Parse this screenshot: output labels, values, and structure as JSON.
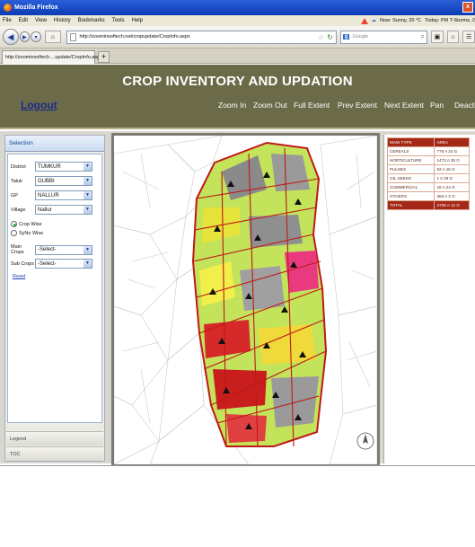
{
  "window": {
    "title": "Mozilla Firefox",
    "close_glyph": "x"
  },
  "menu": [
    "File",
    "Edit",
    "View",
    "History",
    "Bookmarks",
    "Tools",
    "Help"
  ],
  "status": {
    "weather": "Now: Sunny, 20 °C",
    "today": "Today: PM T-Storms, 2"
  },
  "browser": {
    "url": "http://zoominsoftech.net/cropupdate/CropInfo.aspx",
    "search_placeholder": "Google",
    "tab_title": "http://zoominsoftech....update/CropInfo.aspx",
    "new_tab": "+"
  },
  "app": {
    "title": "CROP INVENTORY AND UPDATION",
    "logout": "Logout",
    "toolbar": [
      "Zoom In",
      "Zoom Out",
      "Full Extent",
      "Prev Extent",
      "Next Extent",
      "Pan",
      "Deactivate"
    ]
  },
  "sidebar": {
    "header": "Selection",
    "fields": {
      "district": {
        "label": "District",
        "value": "TUMKUR"
      },
      "taluk": {
        "label": "Taluk",
        "value": "GUBBI"
      },
      "gp": {
        "label": "GP",
        "value": "NALLUR"
      },
      "village": {
        "label": "Village",
        "value": "Nallur"
      },
      "main_crops": {
        "label": "Main Crops",
        "value": "-Select-"
      },
      "sub_crops": {
        "label": "Sub Crops",
        "value": "-Select-"
      }
    },
    "radios": {
      "crop_wise": "Crop Wise",
      "syno_wise": "SyNo Wise"
    },
    "reset": "Reset",
    "legend": "Legend",
    "toc": "TOC"
  },
  "crop_table": {
    "headers": [
      "MAIN TYPE",
      "AREA"
    ],
    "rows": [
      [
        "CEREALS",
        "775 A 24 G"
      ],
      [
        "HORTICULTURE",
        "1473 A 35 G"
      ],
      [
        "PULSES",
        "52 A 16 G"
      ],
      [
        "OIL SEEDS",
        "1 A 29 G"
      ],
      [
        "COMMERCIAL",
        "18 A 24 G"
      ],
      [
        "OTHERS",
        "383 A 2 G"
      ]
    ],
    "total": [
      "TOTAL",
      "2708 A 12 G"
    ]
  }
}
